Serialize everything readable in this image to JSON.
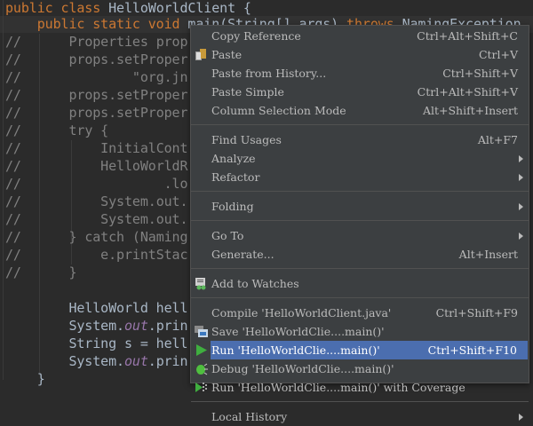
{
  "editor": {
    "lines": [
      {
        "segs": [
          [
            "kw",
            "public class "
          ],
          [
            "",
            "HelloWorldClient {"
          ]
        ]
      },
      {
        "segs": [
          [
            "kw",
            "    public static void "
          ],
          [
            "",
            "main(String[] args) "
          ],
          [
            "kw",
            "throws "
          ],
          [
            "",
            "NamingException"
          ]
        ]
      },
      {
        "segs": [
          [
            "cm",
            "//"
          ],
          [
            "cm",
            "      Properties prop"
          ]
        ]
      },
      {
        "segs": [
          [
            "cm",
            "//"
          ],
          [
            "cm",
            "      props.setProper"
          ]
        ]
      },
      {
        "segs": [
          [
            "cm",
            "//"
          ],
          [
            "cm",
            "              \"org.jn"
          ]
        ]
      },
      {
        "segs": [
          [
            "cm",
            "//"
          ],
          [
            "cm",
            "      props.setProper"
          ]
        ]
      },
      {
        "segs": [
          [
            "cm",
            "//"
          ],
          [
            "cm",
            "      props.setProper"
          ]
        ]
      },
      {
        "segs": [
          [
            "cm",
            "//"
          ],
          [
            "cm",
            "      try {"
          ]
        ]
      },
      {
        "segs": [
          [
            "cm",
            "//"
          ],
          [
            "cm",
            "          InitialCont"
          ]
        ]
      },
      {
        "segs": [
          [
            "cm",
            "//"
          ],
          [
            "cm",
            "          HelloWorldR"
          ]
        ]
      },
      {
        "segs": [
          [
            "cm",
            "//"
          ],
          [
            "cm",
            "                  .lo"
          ]
        ]
      },
      {
        "segs": [
          [
            "cm",
            "//"
          ],
          [
            "cm",
            "          System.out."
          ]
        ]
      },
      {
        "segs": [
          [
            "cm",
            "//"
          ],
          [
            "cm",
            "          System.out."
          ]
        ]
      },
      {
        "segs": [
          [
            "cm",
            "//"
          ],
          [
            "cm",
            "      } catch (Naming"
          ]
        ]
      },
      {
        "segs": [
          [
            "cm",
            "//"
          ],
          [
            "cm",
            "          e.printStac"
          ]
        ]
      },
      {
        "segs": [
          [
            "cm",
            "//"
          ],
          [
            "cm",
            "      }"
          ]
        ]
      },
      {
        "segs": []
      },
      {
        "segs": [
          [
            "",
            "        HelloWorld hell"
          ]
        ]
      },
      {
        "segs": [
          [
            "",
            "        System."
          ],
          [
            "fld",
            "out"
          ],
          [
            "",
            ".prin"
          ]
        ]
      },
      {
        "segs": [
          [
            "",
            "        String s = hell"
          ]
        ]
      },
      {
        "segs": [
          [
            "",
            "        System."
          ],
          [
            "fld",
            "out"
          ],
          [
            "",
            ".prin"
          ]
        ]
      },
      {
        "segs": [
          [
            "",
            "    }"
          ]
        ]
      }
    ]
  },
  "context_menu": {
    "groups": [
      [
        {
          "label": "Copy Reference",
          "shortcut": "Ctrl+Alt+Shift+C"
        },
        {
          "label": "Paste",
          "shortcut": "Ctrl+V",
          "icon": "paste-icon"
        },
        {
          "label": "Paste from History...",
          "shortcut": "Ctrl+Shift+V"
        },
        {
          "label": "Paste Simple",
          "shortcut": "Ctrl+Alt+Shift+V"
        },
        {
          "label": "Column Selection Mode",
          "shortcut": "Alt+Shift+Insert"
        }
      ],
      [
        {
          "label": "Find Usages",
          "shortcut": "Alt+F7"
        },
        {
          "label": "Analyze",
          "submenu": true
        },
        {
          "label": "Refactor",
          "submenu": true
        }
      ],
      [
        {
          "label": "Folding",
          "submenu": true
        }
      ],
      [
        {
          "label": "Go To",
          "submenu": true
        },
        {
          "label": "Generate...",
          "shortcut": "Alt+Insert"
        }
      ],
      [
        {
          "label": "Add to Watches",
          "icon": "watch-icon"
        }
      ],
      [
        {
          "label": "Compile 'HelloWorldClient.java'",
          "shortcut": "Ctrl+Shift+F9"
        },
        {
          "label": "Save 'HelloWorldClie....main()'",
          "icon": "save-config-icon"
        },
        {
          "label": "Run 'HelloWorldClie....main()'",
          "shortcut": "Ctrl+Shift+F10",
          "icon": "run-icon",
          "selected": true
        },
        {
          "label": "Debug 'HelloWorldClie....main()'",
          "icon": "debug-icon"
        },
        {
          "label": "Run 'HelloWorldClie....main()' with Coverage",
          "icon": "coverage-icon"
        }
      ],
      [
        {
          "label": "Local History",
          "submenu": true
        }
      ]
    ]
  },
  "colors": {
    "accent": "#4b6eaf",
    "keyword": "#cc7832",
    "run": "#3fae3f"
  }
}
